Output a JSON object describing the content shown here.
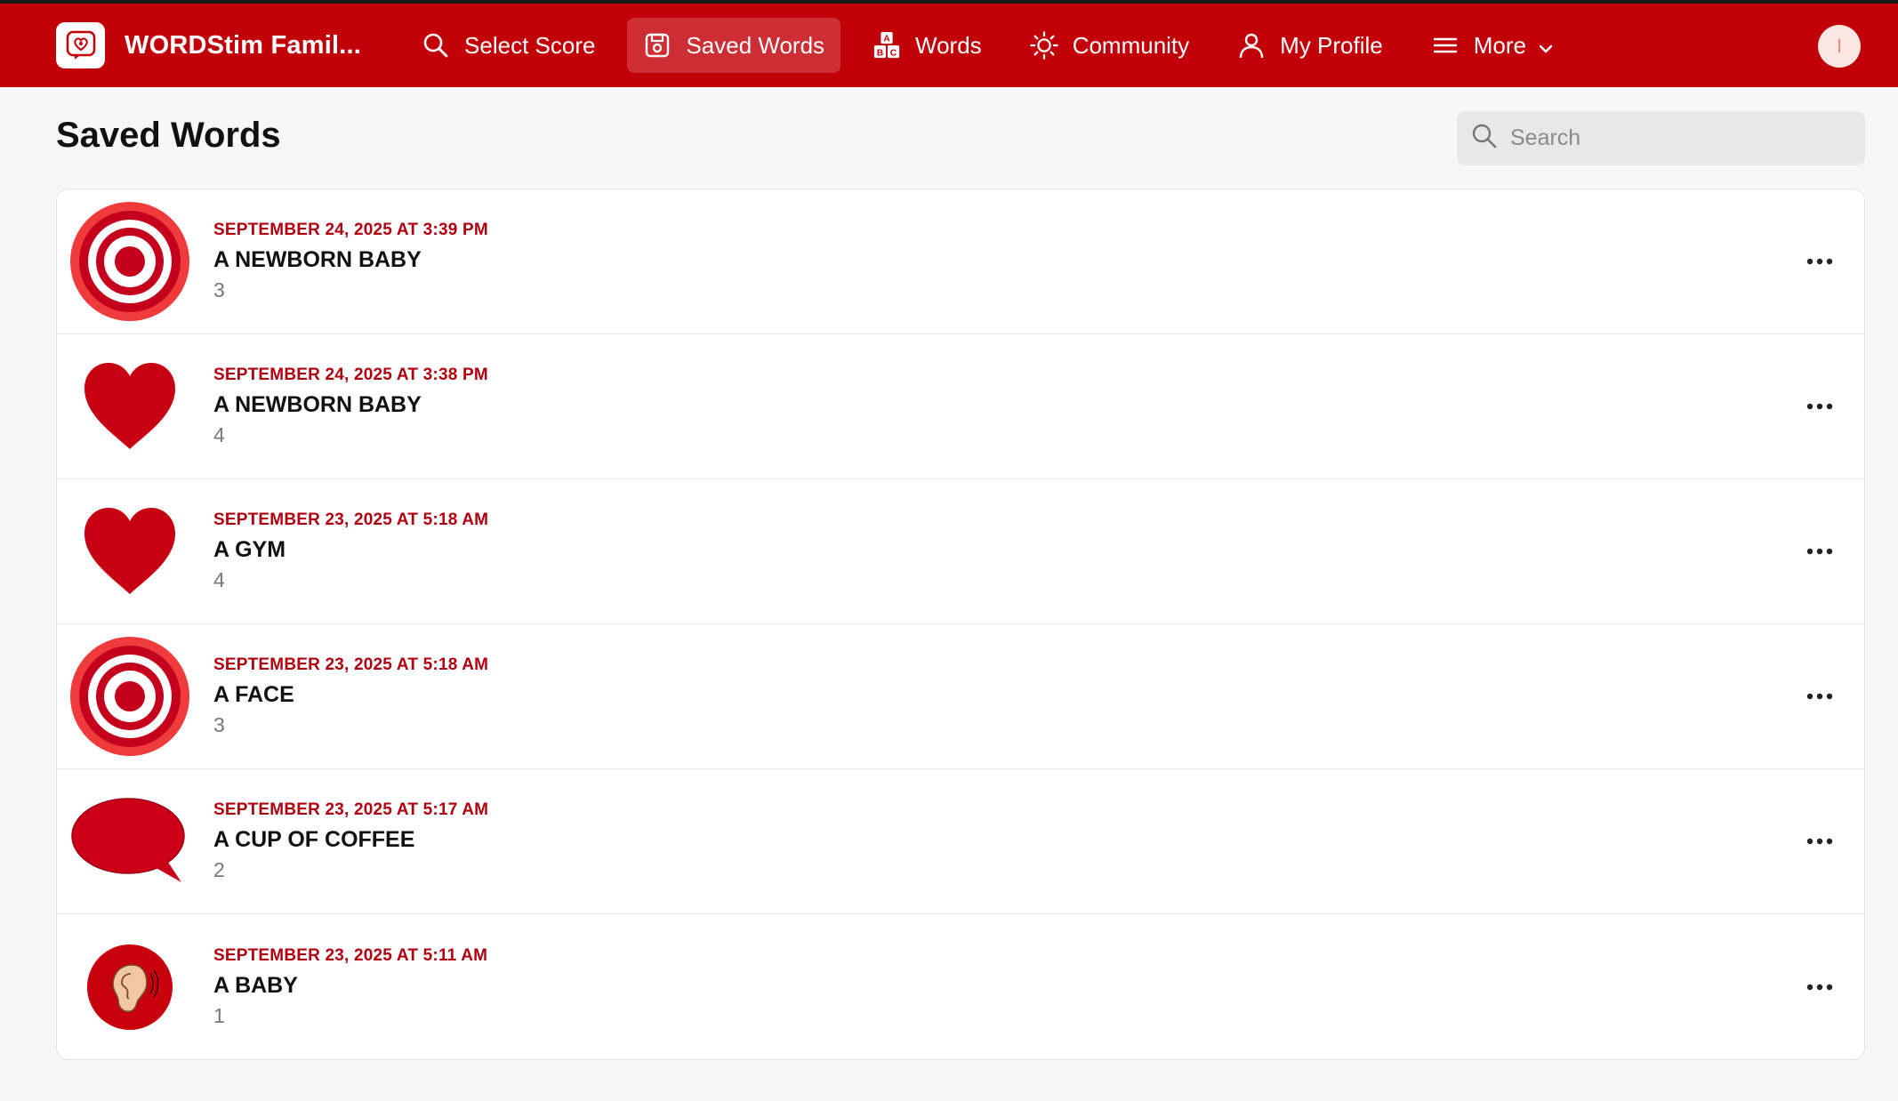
{
  "app": {
    "name": "WORDStim Famil..."
  },
  "nav": {
    "items": [
      {
        "label": "Select Score",
        "icon": "search-icon"
      },
      {
        "label": "Saved Words",
        "icon": "saved-icon",
        "active": true
      },
      {
        "label": "Words",
        "icon": "abc-blocks-icon"
      },
      {
        "label": "Community",
        "icon": "sun-icon"
      },
      {
        "label": "My Profile",
        "icon": "person-icon"
      },
      {
        "label": "More",
        "icon": "menu-icon"
      }
    ]
  },
  "user": {
    "initial": "I"
  },
  "page": {
    "title": "Saved Words"
  },
  "search": {
    "placeholder": "Search"
  },
  "colors": {
    "brand": "#c20008",
    "date": "#b00010"
  },
  "saved_words": [
    {
      "date": "SEPTEMBER 24, 2025 AT 3:39 PM",
      "word": "A NEWBORN BABY",
      "count": "3",
      "icon": "target-icon"
    },
    {
      "date": "SEPTEMBER 24, 2025 AT 3:38 PM",
      "word": "A NEWBORN BABY",
      "count": "4",
      "icon": "heart-icon"
    },
    {
      "date": "SEPTEMBER 23, 2025 AT 5:18 AM",
      "word": "A GYM",
      "count": "4",
      "icon": "heart-icon"
    },
    {
      "date": "SEPTEMBER 23, 2025 AT 5:18 AM",
      "word": "A FACE",
      "count": "3",
      "icon": "target-icon"
    },
    {
      "date": "SEPTEMBER 23, 2025 AT 5:17 AM",
      "word": "A CUP OF COFFEE",
      "count": "2",
      "icon": "speech-bubble-icon"
    },
    {
      "date": "SEPTEMBER 23, 2025 AT 5:11 AM",
      "word": "A BABY",
      "count": "1",
      "icon": "ear-icon"
    }
  ]
}
